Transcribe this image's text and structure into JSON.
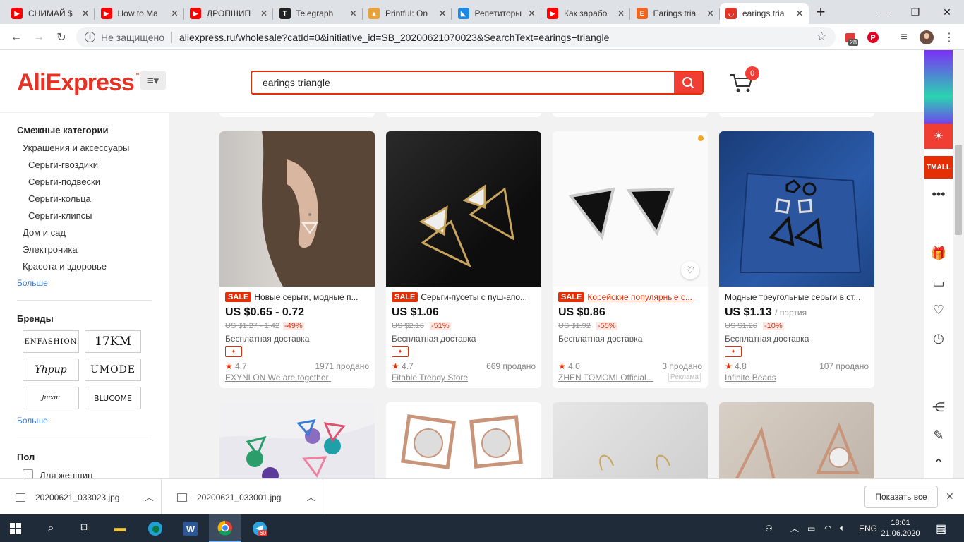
{
  "tabs": [
    {
      "title": "СНИМАЙ $",
      "icon": "youtube-icon",
      "color": "#ff0000"
    },
    {
      "title": "How to Ma",
      "icon": "youtube-icon",
      "color": "#ff0000"
    },
    {
      "title": "ДРОПШИП",
      "icon": "youtube-icon",
      "color": "#ff0000"
    },
    {
      "title": "Telegraph",
      "icon": "telegraph-icon",
      "color": "#222222"
    },
    {
      "title": "Printful: On",
      "icon": "printful-icon",
      "color": "#e8a23a"
    },
    {
      "title": "Репетиторы",
      "icon": "repetitor-icon",
      "color": "#1e88e5"
    },
    {
      "title": "Как зарабо",
      "icon": "youtube-icon",
      "color": "#ff0000"
    },
    {
      "title": "Earings tria",
      "icon": "etsy-icon",
      "color": "#f1641e"
    },
    {
      "title": "earings tria",
      "icon": "aliexpress-icon",
      "color": "#e43225",
      "active": true
    }
  ],
  "address": {
    "insecure": "Не защищено",
    "url": "aliexpress.ru/wholesale?catId=0&initiative_id=SB_20200621070023&SearchText=earings+triangle",
    "ext_badge": "28"
  },
  "header": {
    "logo": "AliExpress",
    "logo_tm": "™",
    "search_value": "earings triangle",
    "cart_count": "0"
  },
  "sidebar": {
    "related_title": "Смежные категории",
    "cats": [
      "Украшения и аксессуары",
      "Серьги-гвоздики",
      "Серьги-подвески",
      "Серьги-кольца",
      "Серьги-клипсы",
      "Дом и сад",
      "Электроника",
      "Красота и здоровье"
    ],
    "more": "Больше",
    "brands_title": "Бренды",
    "brands": [
      "ENFASHION",
      "17KM",
      "Yhpup",
      "UMODE",
      "Jiuxiu",
      "BLUCOME"
    ],
    "brands_more": "Больше",
    "gender_title": "Пол",
    "gender_opt": "Для женщин"
  },
  "products": [
    {
      "sale": "SALE",
      "title": "Новые серьги, модные п...",
      "price": "US $0.65 - 0.72",
      "unit": "",
      "old": "US $1.27 - 1.42",
      "disc": "-49%",
      "ship": "Бесплатная доставка",
      "rating": "4.7",
      "sold": "1971 продано",
      "store": "EXYNLON We are together Store",
      "ad": ""
    },
    {
      "sale": "SALE",
      "title": "Серьги-пусеты с пуш-апо...",
      "price": "US $1.06",
      "unit": "",
      "old": "US $2.16",
      "disc": "-51%",
      "ship": "Бесплатная доставка",
      "rating": "4.7",
      "sold": "669 продано",
      "store": "Fitable Trendy Store",
      "ad": ""
    },
    {
      "sale": "SALE",
      "title": "Корейские популярные с...",
      "price": "US $0.86",
      "unit": "",
      "old": "US $1.92",
      "disc": "-55%",
      "ship": "Бесплатная доставка",
      "rating": "4.0",
      "sold": "3 продано",
      "store": "ZHEN TOMOMI Official...",
      "ad": "Реклама"
    },
    {
      "sale": "",
      "title": "Модные треугольные серьги в ст...",
      "price": "US $1.13",
      "unit": "/ партия",
      "old": "US $1.26",
      "disc": "-10%",
      "ship": "Бесплатная доставка",
      "rating": "4.8",
      "sold": "107 продано",
      "store": "Infinite Beads",
      "ad": ""
    }
  ],
  "downloads": {
    "files": [
      "20200621_033023.jpg",
      "20200621_033001.jpg"
    ],
    "show_all": "Показать все"
  },
  "taskbar": {
    "lang": "ENG",
    "time": "18:01",
    "date": "21.06.2020",
    "notif": "3",
    "telegram_badge": "60"
  }
}
